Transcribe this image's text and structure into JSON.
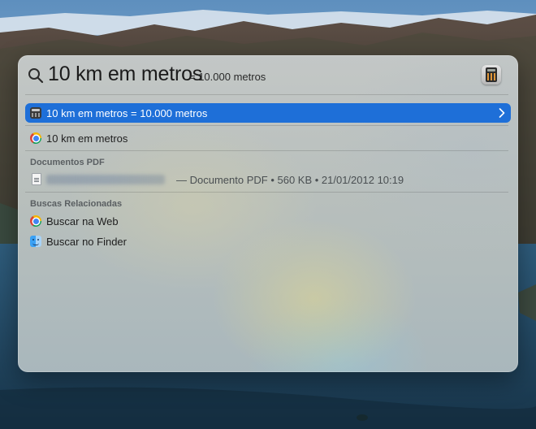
{
  "search": {
    "query": "10 km em metros",
    "inline_result": "= 10.000 metros",
    "top_app_icon": "calculator-icon"
  },
  "top_hit": {
    "label": "10 km em metros = 10.000 metros",
    "icon": "calculator-icon",
    "accent_color": "#1e6fd8"
  },
  "web_suggestion": {
    "label": "10 km em metros",
    "icon": "chrome-icon"
  },
  "pdf_section": {
    "header": "Documentos PDF",
    "items": [
      {
        "meta": "— Documento PDF • 560 KB • 21/01/2012 10:19",
        "icon": "pdf-document-icon"
      }
    ]
  },
  "related_section": {
    "header": "Buscas Relacionadas",
    "items": [
      {
        "label": "Buscar na Web",
        "icon": "chrome-icon"
      },
      {
        "label": "Buscar no Finder",
        "icon": "finder-icon"
      }
    ]
  }
}
